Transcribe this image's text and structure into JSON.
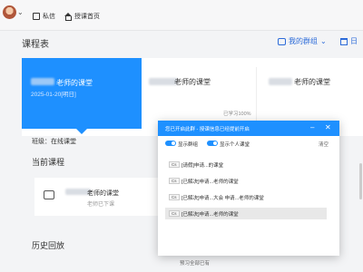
{
  "topbar": {
    "messages_label": "私信",
    "home_label": "授课首页"
  },
  "page": {
    "title": "课程表"
  },
  "header_actions": {
    "my_groups_label": "我的群组",
    "calendar_label": "日"
  },
  "course_cards": [
    {
      "title": "老师的课堂",
      "date": "2025-01-20[明日]",
      "progress": ""
    },
    {
      "title": "老师的课堂",
      "progress": "已学习100%"
    },
    {
      "title": "老师的课堂",
      "progress": ""
    }
  ],
  "left": {
    "class_label": "班级：在线课堂",
    "current_heading": "当前课程",
    "current_card_title": "老师的课堂",
    "current_card_status": "老师已下课",
    "history_heading": "历史回放"
  },
  "dialog": {
    "title": "您已开启此群 - 授课信息已经提前开启",
    "toggle1_label": "显示群组",
    "toggle2_label": "显示个人课堂",
    "clear_label": "清空",
    "rows": [
      {
        "tag": "Cs",
        "text": "[请假]申请...的课堂"
      },
      {
        "tag": "Cs",
        "text": "[已解决]申请...老师的课堂"
      },
      {
        "tag": "Cs",
        "text": "[已解决]申请...大会 申请...老师的课堂"
      },
      {
        "tag": "Cs",
        "text": "[已解决]申请...老师的课堂"
      }
    ]
  },
  "bottom": {
    "text": "预习全部已有"
  }
}
